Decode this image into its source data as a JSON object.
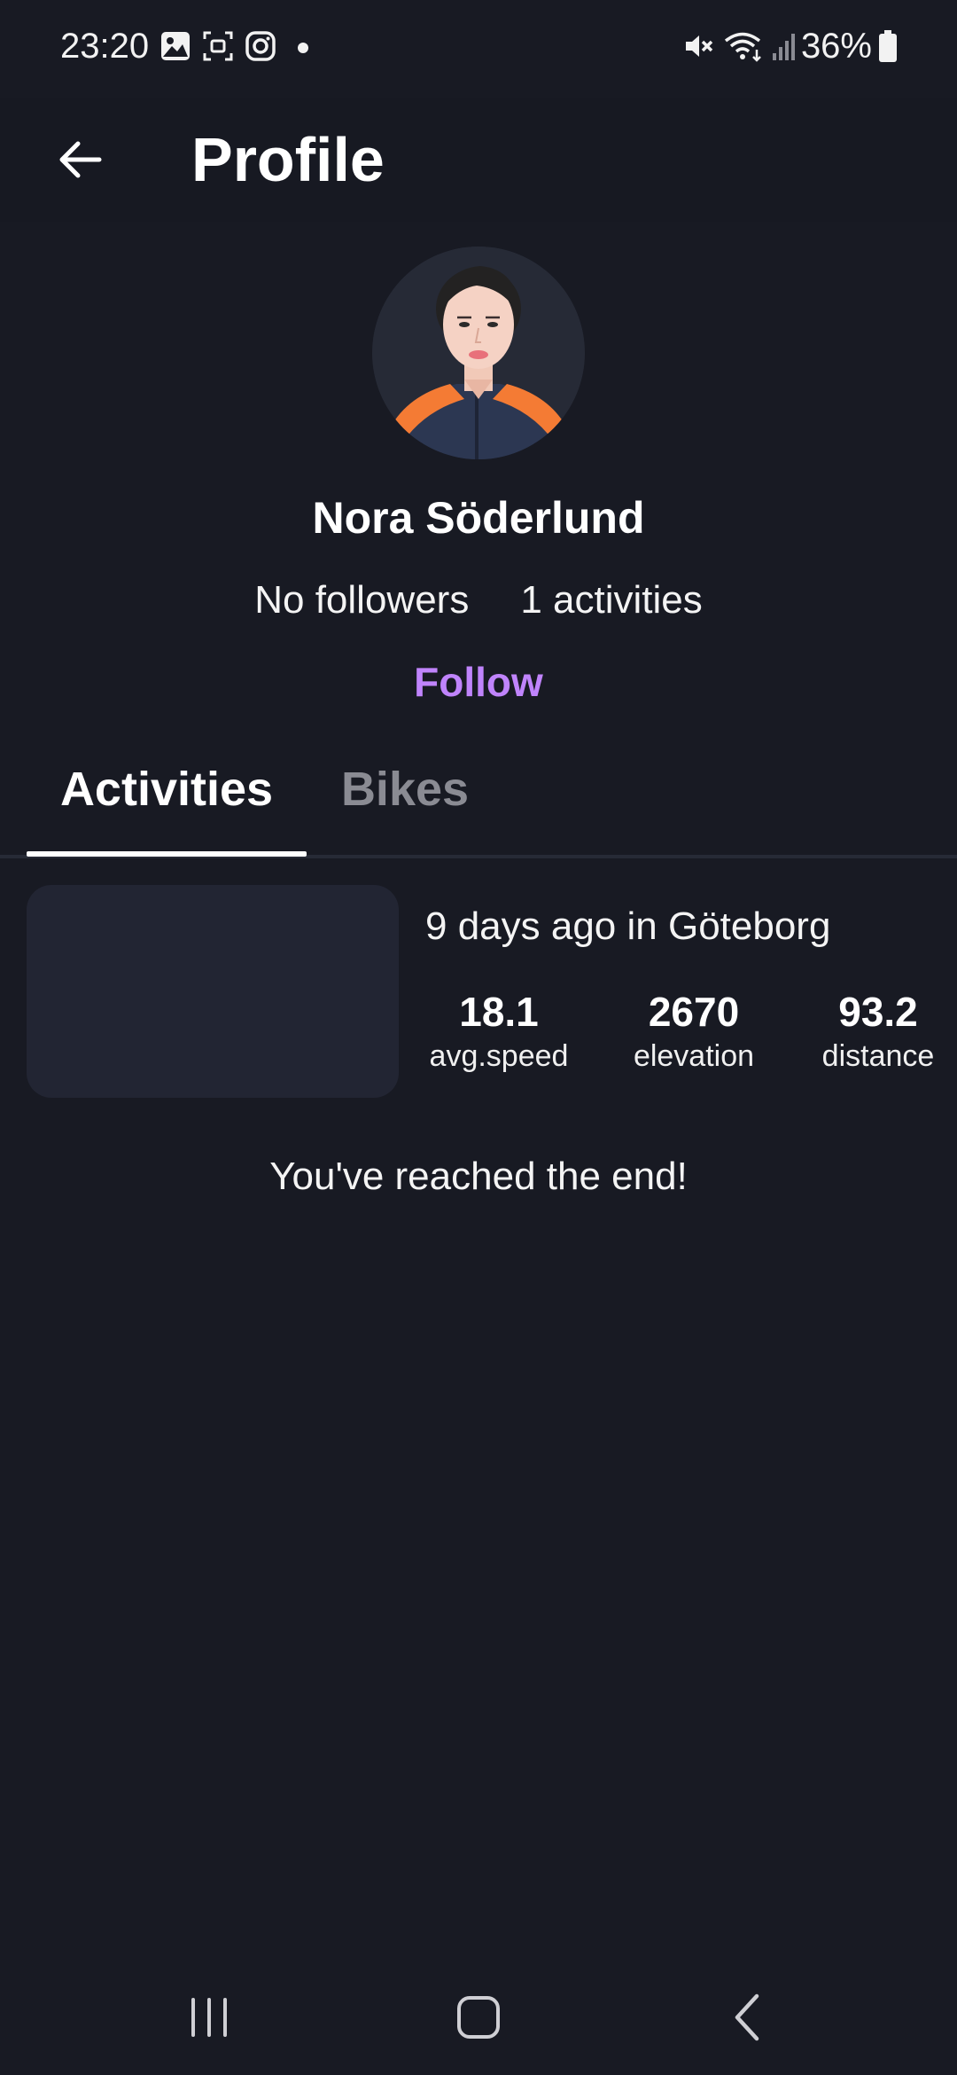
{
  "status_bar": {
    "time": "23:20",
    "battery_percent": "36%",
    "icons": [
      "gallery-icon",
      "screenshot-icon",
      "instagram-icon",
      "notification-dot-icon",
      "mute-icon",
      "wifi-icon",
      "signal-icon",
      "battery-icon"
    ]
  },
  "app_bar": {
    "title": "Profile",
    "back_icon": "arrow-left-icon"
  },
  "profile": {
    "name": "Nora Söderlund",
    "followers": "No followers",
    "activities_count": "1 activities",
    "follow_label": "Follow"
  },
  "tabs": [
    {
      "label": "Activities",
      "selected": true
    },
    {
      "label": "Bikes",
      "selected": false
    }
  ],
  "activities": [
    {
      "title": "9 days ago in Göteborg",
      "metrics": [
        {
          "value": "18.1",
          "label": "avg.speed"
        },
        {
          "value": "2670",
          "label": "elevation"
        },
        {
          "value": "93.2",
          "label": "distance"
        }
      ]
    }
  ],
  "end_message": "You've reached the end!",
  "nav_bar": {
    "icons": [
      "recent-apps-icon",
      "home-icon",
      "back-icon"
    ]
  },
  "colors": {
    "background": "#181a23",
    "accent": "#c084fc",
    "tab_inactive": "#8a8b93",
    "card": "#222533"
  }
}
